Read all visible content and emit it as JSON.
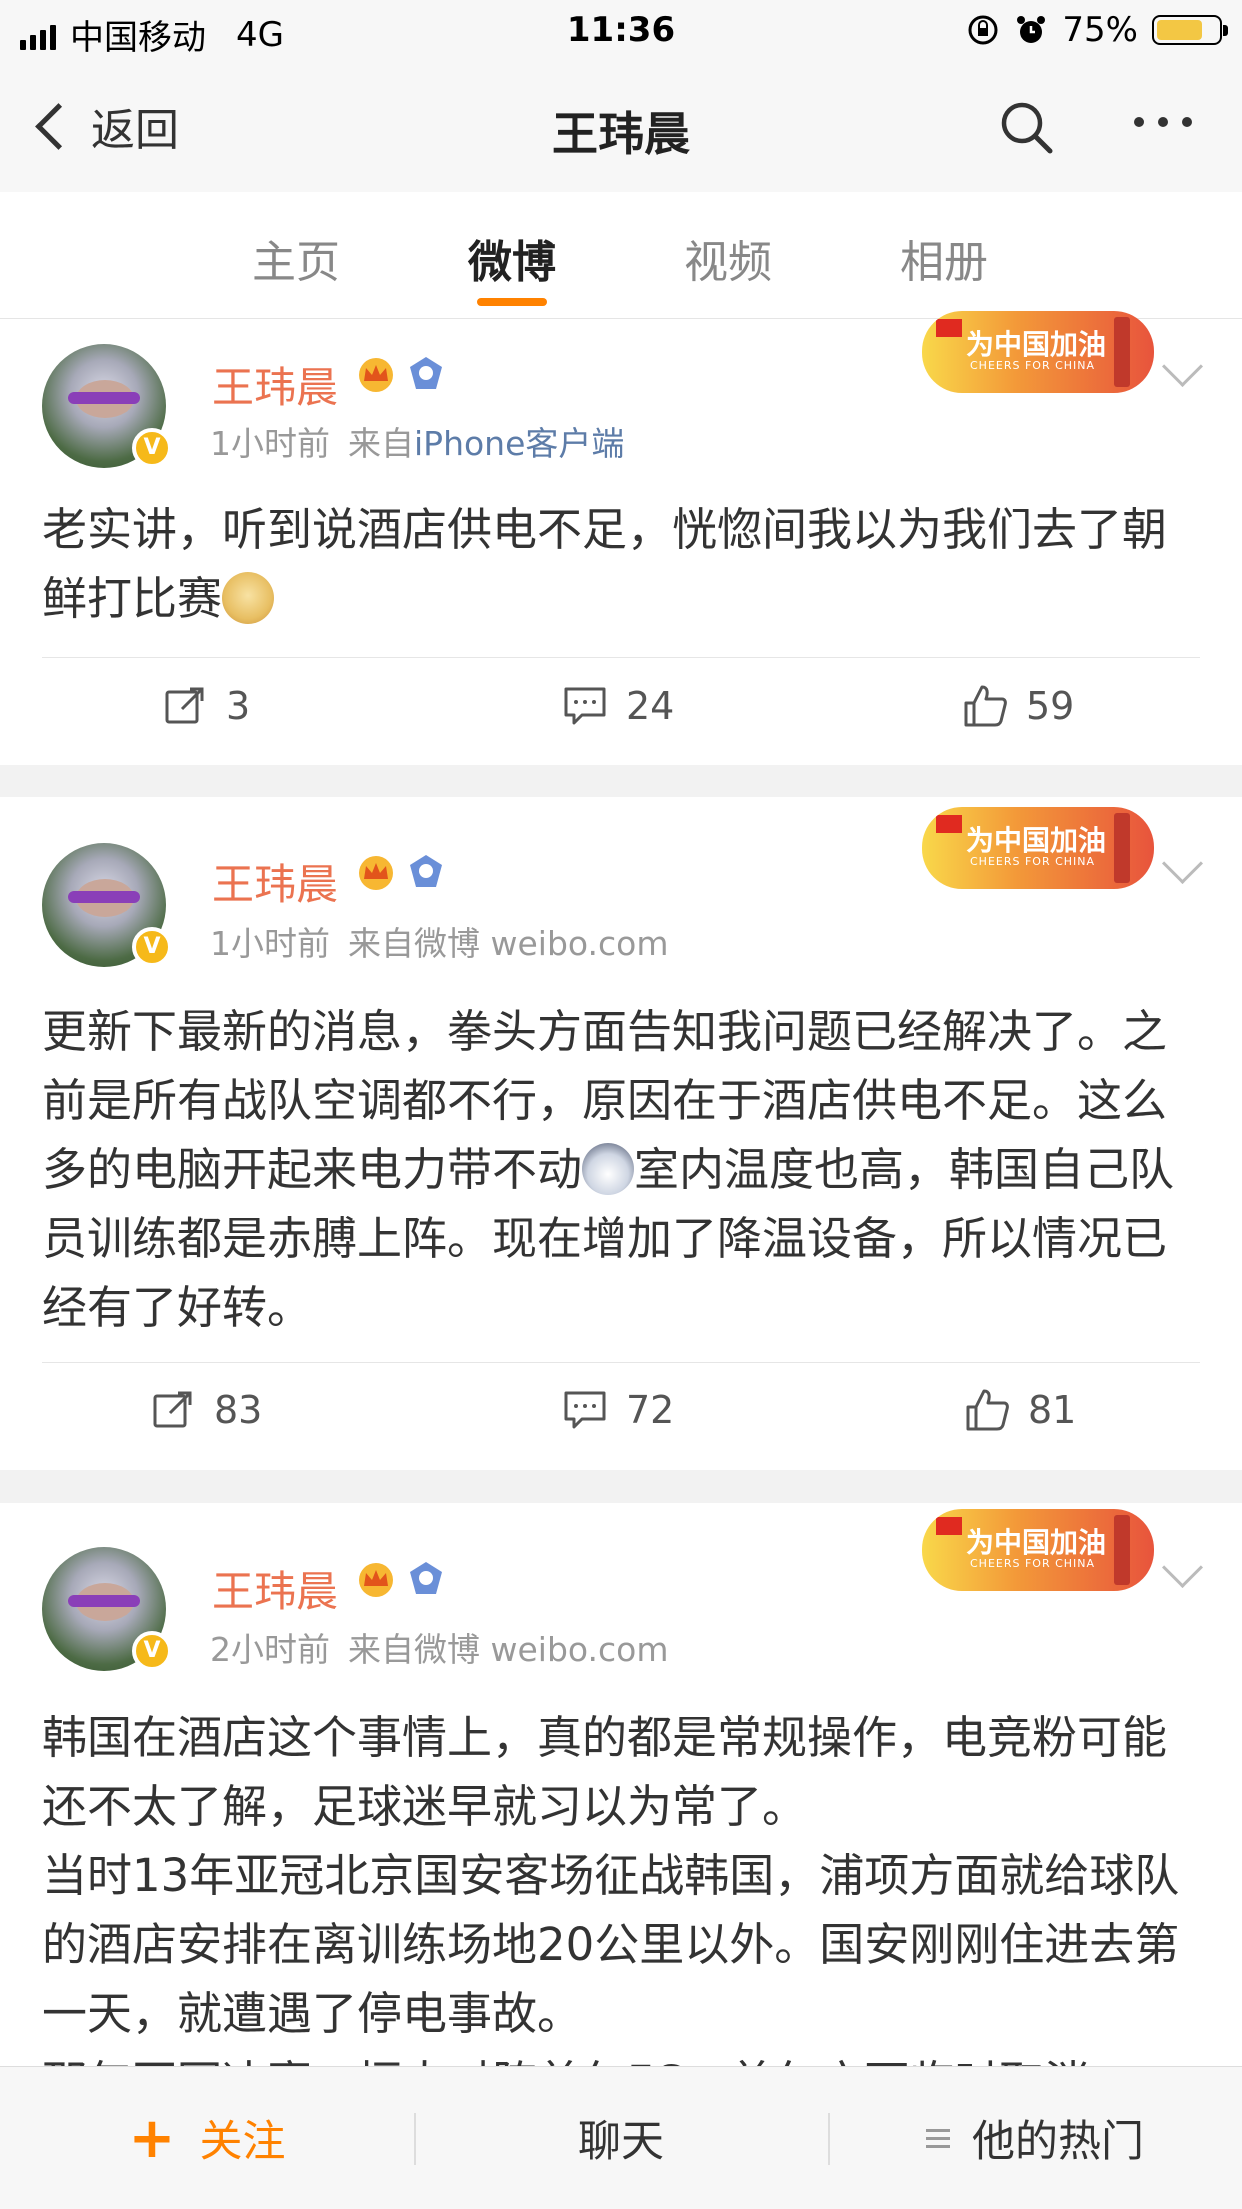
{
  "status_bar": {
    "carrier": "中国移动",
    "network": "4G",
    "time": "11:36",
    "battery": "75%",
    "battery_level": 0.75
  },
  "nav": {
    "back_label": "返回",
    "title": "王玮晨"
  },
  "tabs": [
    {
      "label": "主页"
    },
    {
      "label": "微博"
    },
    {
      "label": "视频"
    },
    {
      "label": "相册"
    }
  ],
  "cheers_badge": {
    "text": "为中国加油",
    "sub": "CHEERS FOR CHINA"
  },
  "posts": [
    {
      "user": "王玮晨",
      "time": "1小时前",
      "source_prefix": "来自",
      "source": "iPhone客户端",
      "text": "老实讲，听到说酒店供电不足，恍惚间我以为我们去了朝鲜打比赛",
      "reposts": "3",
      "comments": "24",
      "likes": "59"
    },
    {
      "user": "王玮晨",
      "time": "1小时前",
      "source_prefix": "来自微博 weibo.com",
      "source": "",
      "text_a": "更新下最新的消息，拳头方面告知我问题已经解决了。之前是所有战队空调都不行，原因在于酒店供电不足。这么多的电脑开起来电力带不动",
      "text_b": "室内温度也高，韩国自己队员训练都是赤膊上阵。现在增加了降温设备，所以情况已经有了好转。",
      "reposts": "83",
      "comments": "72",
      "likes": "81"
    },
    {
      "user": "王玮晨",
      "time": "2小时前",
      "source_prefix": "来自微博 weibo.com",
      "source": "",
      "text_p1": "韩国在酒店这个事情上，真的都是常规操作，电竞粉可能还不太了解，足球迷早就习以为常了。",
      "text_p2": "当时13年亚冠北京国安客场征战韩国，浦项方面就给球队的酒店安排在离训练场地20公里以外。国安刚刚住进去第一天，就遭遇了停电事故。",
      "text_p3": "那年亚冠决赛，恒大对阵首尔FC，首尔方面临时取消"
    }
  ],
  "bottom_bar": {
    "follow": "关注",
    "chat": "聊天",
    "hot": "他的热门"
  }
}
